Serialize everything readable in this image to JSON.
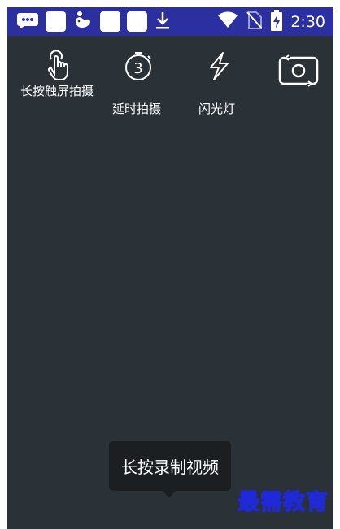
{
  "status_bar": {
    "time": "2:30",
    "left_icons": [
      "message-icon",
      "square-icon",
      "bird-icon",
      "square-icon",
      "square-icon",
      "download-icon"
    ],
    "right_icons": [
      "wifi-icon",
      "no-sim-icon",
      "battery-charging-icon"
    ],
    "background": "#2b2fa0"
  },
  "toolbar": {
    "items": [
      {
        "icon": "touch-icon",
        "label": "长按触屏拍摄"
      },
      {
        "icon": "timer-icon",
        "label": "延时拍摄",
        "badge": "3"
      },
      {
        "icon": "flash-icon",
        "label": "闪光灯"
      },
      {
        "icon": "switch-camera-icon",
        "label": ""
      }
    ]
  },
  "tooltip": {
    "text": "长按录制视频"
  },
  "watermark": {
    "text": "最需教育"
  },
  "colors": {
    "screen_bg": "#2a3137",
    "tooltip_bg": "#1c1f22",
    "watermark_stroke": "#1f2ad6"
  }
}
